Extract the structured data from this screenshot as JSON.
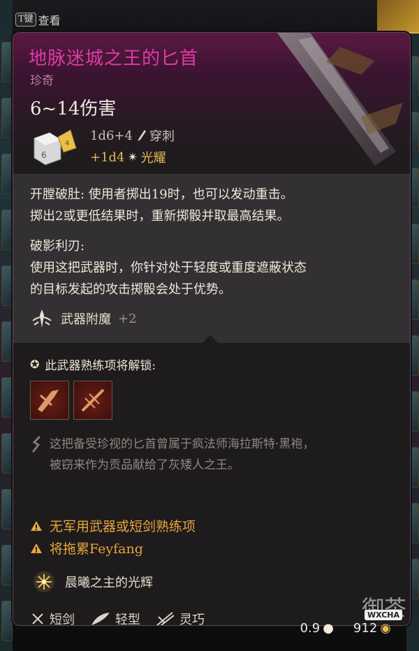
{
  "top": {
    "key": "T键",
    "label": "查看"
  },
  "item": {
    "name": "地脉迷城之王的匕首",
    "rarity": "珍奇",
    "damage_range": "6~14伤害",
    "damage_dice": "1d6+4",
    "damage_type": "穿刺",
    "bonus_dice": "+1d4",
    "bonus_type": "光耀"
  },
  "abilities": {
    "line1": "开膛破肚: 使用者掷出19时，也可以发动重击。",
    "line2": "掷出2或更低结果时，重新掷骰并取最高结果。",
    "line3": "破影利刃:",
    "line4": "使用这把武器时，你针对处于轻度或重度遮蔽状态",
    "line5": "的目标发起的攻击掷骰会处于优势。",
    "enchant_label": "武器附魔",
    "enchant_value": "+2"
  },
  "proficiency": {
    "unlock_label": "此武器熟练项将解锁:",
    "icons": [
      "slash-proficiency-icon",
      "pierce-proficiency-icon"
    ]
  },
  "flavor": {
    "line1": "这把备受珍视的匕首曾属于疯法师海拉斯特·黑袍，",
    "line2": "被窃来作为贡品献给了灰矮人之王。"
  },
  "warnings": [
    "无军用武器或短剑熟练项",
    "将拖累Feyfang"
  ],
  "blessing": "晨曦之主的光辉",
  "tags": [
    "短剑",
    "轻型",
    "灵巧"
  ],
  "footer": {
    "weight": "0.9",
    "price": "912"
  },
  "watermark": {
    "text": "御茶",
    "badge": "WXCHA"
  },
  "colors": {
    "title": "#e03aa6",
    "rarity": "#c17ca6",
    "radiant": "#e6bb52",
    "warning": "#e8a63c"
  }
}
